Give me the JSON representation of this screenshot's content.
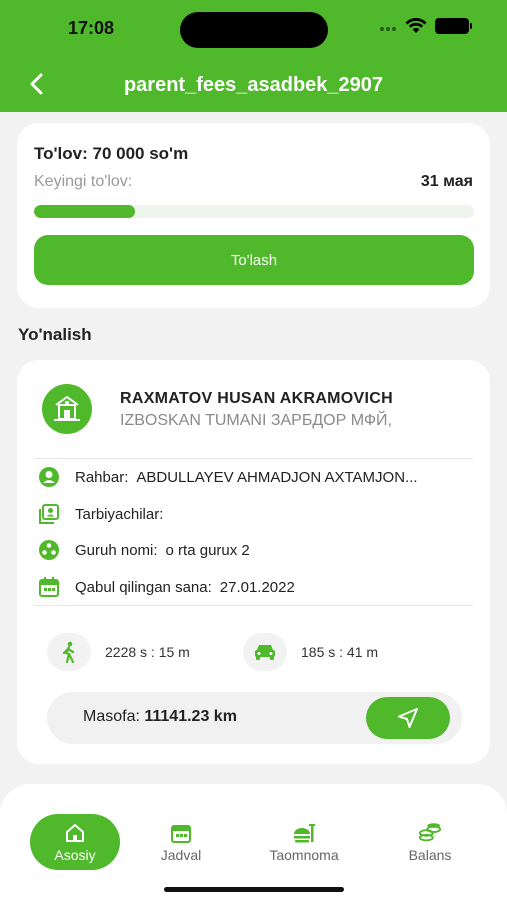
{
  "status_bar": {
    "time": "17:08"
  },
  "header": {
    "title": "parent_fees_asadbek_2907"
  },
  "fee": {
    "amount_label": "To'lov: 70 000 so'm",
    "next_label": "Keyingi to'lov:",
    "next_date": "31 мая",
    "progress_fraction": 0.23,
    "pay_button_label": "To'lash"
  },
  "direction": {
    "section_title": "Yo'nalish",
    "org_name": "RAXMATOV HUSAN AKRAMOVICH",
    "org_address": "IZBOSKAN TUMANI ЗАРБДОР МФЙ,",
    "rows": [
      {
        "label": "Rahbar:",
        "value": "ABDULLAYEV AHMADJON AXTAMJON..."
      },
      {
        "label": "Tarbiyachilar:",
        "value": ""
      },
      {
        "label": "Guruh nomi:",
        "value": "o rta gurux 2"
      },
      {
        "label": "Qabul qilingan sana:",
        "value": "27.01.2022"
      }
    ],
    "walk_time": "2228 s : 15 m",
    "car_time": "185 s : 41 m",
    "distance_label": "Masofa:",
    "distance_value": "11141.23 km"
  },
  "tabs": [
    {
      "label": "Asosiy",
      "active": true,
      "icon": "home-icon"
    },
    {
      "label": "Jadval",
      "active": false,
      "icon": "calendar-icon"
    },
    {
      "label": "Taomnoma",
      "active": false,
      "icon": "food-icon"
    },
    {
      "label": "Balans",
      "active": false,
      "icon": "coins-icon"
    }
  ],
  "colors": {
    "accent": "#4fb82b",
    "background": "#f2f2f2",
    "card": "#ffffff",
    "muted": "#999999"
  }
}
